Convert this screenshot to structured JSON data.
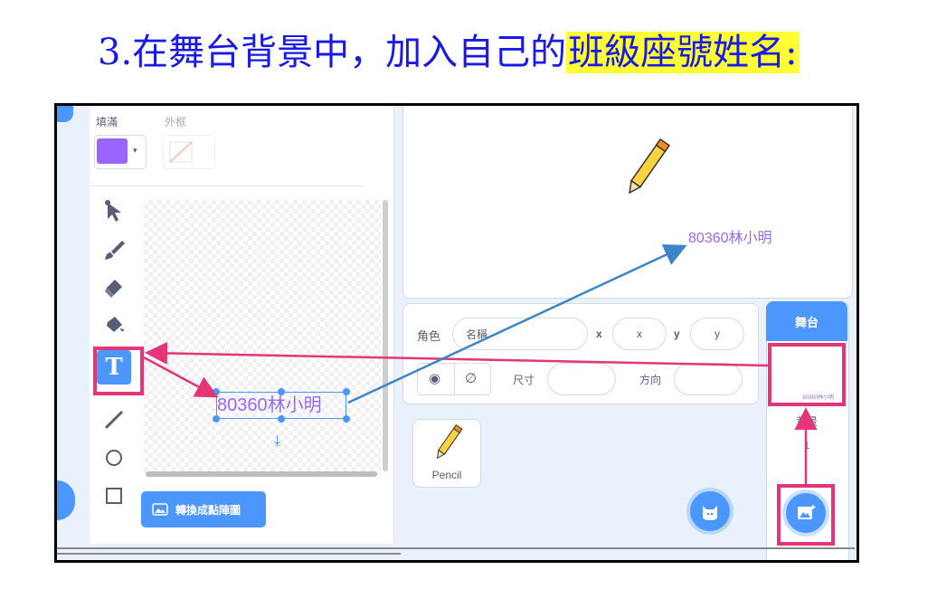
{
  "heading": {
    "prefix": "3.在舞台背景中，加入自己的",
    "highlight": "班級座號姓名:"
  },
  "paint_editor": {
    "fill_label": "填滿",
    "outline_label": "外框",
    "fill_color": "#9966ff",
    "tools": [
      "reshape-icon",
      "brush-icon",
      "eraser-icon",
      "fill-icon",
      "text-icon",
      "line-icon",
      "circle-icon",
      "rectangle-icon"
    ],
    "canvas_text": "80360林小明",
    "convert_button": "轉換成點陣圖"
  },
  "stage": {
    "sprite_text": "80360林小明"
  },
  "sprite_info": {
    "sprite_label": "角色",
    "name_placeholder": "名稱",
    "x_label": "x",
    "x_value": "x",
    "y_label": "y",
    "y_value": "y",
    "size_label": "尺寸",
    "direction_label": "方向"
  },
  "sprites": [
    {
      "name": "Pencil"
    }
  ],
  "stage_panel": {
    "title": "舞台",
    "thumb_text": "80360林小明",
    "backdrop_label": "背景",
    "backdrop_count": "1"
  },
  "colors": {
    "accent": "#4c97ff",
    "highlight": "#e5357a",
    "arrow_blue": "#3a86c8",
    "purple": "#9966ff"
  }
}
